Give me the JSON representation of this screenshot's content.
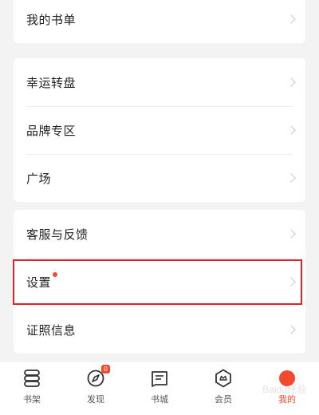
{
  "groups": [
    {
      "items": [
        {
          "label": "我的书单"
        }
      ]
    },
    {
      "items": [
        {
          "label": "幸运转盘"
        },
        {
          "label": "品牌专区"
        },
        {
          "label": "广场"
        }
      ]
    },
    {
      "items": [
        {
          "label": "客服与反馈"
        },
        {
          "label": "设置",
          "has_dot": true
        },
        {
          "label": "证照信息"
        }
      ]
    }
  ],
  "tabbar": {
    "tabs": [
      {
        "label": "书架",
        "icon": "bookshelf-icon"
      },
      {
        "label": "发现",
        "icon": "compass-icon",
        "badge": "0"
      },
      {
        "label": "书城",
        "icon": "book-store-icon"
      },
      {
        "label": "会员",
        "icon": "vip-icon"
      },
      {
        "label": "我的",
        "icon": "profile-icon",
        "active": true
      }
    ]
  },
  "watermark": "Baidu经验",
  "colors": {
    "accent": "#f2492f",
    "highlight_border": "#d9262b",
    "background": "#f3f3f3"
  }
}
